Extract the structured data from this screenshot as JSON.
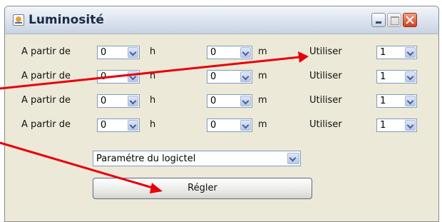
{
  "window": {
    "title": "Luminosité",
    "icon": "java-app-icon"
  },
  "rows": [
    {
      "from_label": "A partir de",
      "hour": "0",
      "h_label": "h",
      "minute": "0",
      "m_label": "m",
      "use_label": "Utiliser",
      "use_value": "1"
    },
    {
      "from_label": "A partir de",
      "hour": "0",
      "h_label": "h",
      "minute": "0",
      "m_label": "m",
      "use_label": "Utiliser",
      "use_value": "1"
    },
    {
      "from_label": "A partir de",
      "hour": "0",
      "h_label": "h",
      "minute": "0",
      "m_label": "m",
      "use_label": "Utiliser",
      "use_value": "1"
    },
    {
      "from_label": "A partir de",
      "hour": "0",
      "h_label": "h",
      "minute": "0",
      "m_label": "m",
      "use_label": "Utiliser",
      "use_value": "1"
    }
  ],
  "mode_select": {
    "value": "Paramétre du logictel"
  },
  "apply_button": {
    "label": "Régler"
  },
  "annotation_color": "#e8000b"
}
